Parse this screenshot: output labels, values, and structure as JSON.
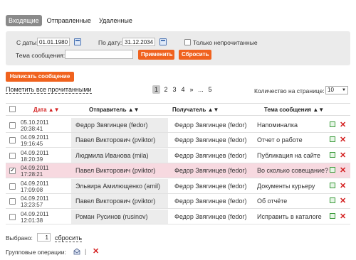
{
  "tabs": [
    {
      "label": "Входящие",
      "active": true
    },
    {
      "label": "Отправленные",
      "active": false
    },
    {
      "label": "Удаленные",
      "active": false
    }
  ],
  "filter": {
    "from_label": "С даты:",
    "from_value": "01.01.1980",
    "to_label": "По дату:",
    "to_value": "31.12.2034",
    "unread_label": "Только непрочитанные",
    "subject_label": "Тема сообщения:",
    "subject_value": "",
    "apply_label": "Применить",
    "reset_label": "Сбросить"
  },
  "compose_label": "Написать сообщение",
  "mark_all_label": "Пометить все прочитанными",
  "pager": {
    "pages": [
      "1",
      "2",
      "3",
      "4",
      "»",
      "...",
      "5"
    ],
    "current": "1"
  },
  "per_page": {
    "label": "Количество на странице:",
    "value": "10"
  },
  "columns": {
    "date": "Дата",
    "sender": "Отправитель",
    "recipient": "Получатель",
    "subject": "Тема сообщения"
  },
  "rows": [
    {
      "date": "05.10.2011",
      "time": "20:38:41",
      "sender": "Федор Звягинцев (fedor)",
      "recipient": "Федор Звягинцев (fedor)",
      "subject": "Напоминалка",
      "checked": false,
      "highlight": false
    },
    {
      "date": "04.09.2011",
      "time": "19:16:45",
      "sender": "Павел Викторович (pviktor)",
      "recipient": "Федор Звягинцев (fedor)",
      "subject": "Отчет о работе",
      "checked": false,
      "highlight": false
    },
    {
      "date": "04.09.2011",
      "time": "18:20:39",
      "sender": "Людмила Иванова (mila)",
      "recipient": "Федор Звягинцев (fedor)",
      "subject": "Публикация на сайте",
      "checked": false,
      "highlight": false
    },
    {
      "date": "04.09.2011",
      "time": "17:28:21",
      "sender": "Павел Викторович (pviktor)",
      "recipient": "Федор Звягинцев (fedor)",
      "subject": "Во сколько совещание?",
      "checked": true,
      "highlight": true
    },
    {
      "date": "04.09.2011",
      "time": "17:09:08",
      "sender": "Эльвира Амилющенко (amil)",
      "recipient": "Федор Звягинцев (fedor)",
      "subject": "Документы курьеру",
      "checked": false,
      "highlight": false
    },
    {
      "date": "04.09.2011",
      "time": "13:23:57",
      "sender": "Павел Викторович (pviktor)",
      "recipient": "Федор Звягинцев (fedor)",
      "subject": "Об отчёте",
      "checked": false,
      "highlight": false
    },
    {
      "date": "04.09.2011",
      "time": "12:01:38",
      "sender": "Роман Русинов (rusinov)",
      "recipient": "Федор Звягинцев (fedor)",
      "subject": "Исправить в каталоге",
      "checked": false,
      "highlight": false
    }
  ],
  "selected": {
    "label": "Выбрано:",
    "count": "1",
    "reset_label": "сбросить"
  },
  "group_ops": {
    "label": "Групповые операции:",
    "separator": "|"
  },
  "icons": {
    "calendar": "calendar-icon",
    "edit": "edit-icon",
    "delete": "delete-x-icon",
    "mark_read": "envelope-icon"
  },
  "colors": {
    "accent": "#f0621e",
    "highlight_row": "#f7d9e0",
    "sort_active": "#d42020"
  }
}
